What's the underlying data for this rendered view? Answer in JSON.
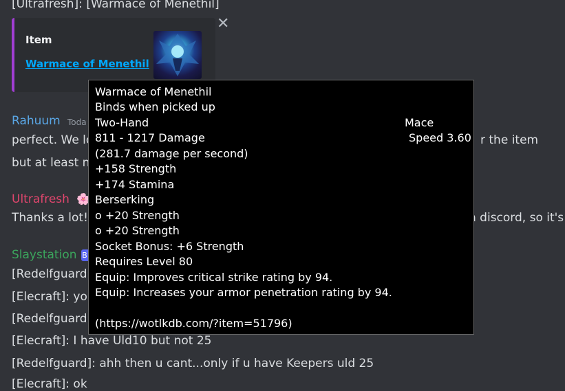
{
  "top_line": "[Ultrafresh]:  [Warmace of Menethil]",
  "embed": {
    "kind": "Item",
    "link": "Warmace of Menethil",
    "close_icon": "close-icon",
    "accent": "#a13ed3"
  },
  "messages": [
    {
      "author": "Rahuum",
      "author_color": "#5aa7e6",
      "timestamp": "Toda",
      "lines": [
        "perfect. We lo",
        "but at least n"
      ],
      "right_fragment": "r the item"
    },
    {
      "author": "Ultrafresh",
      "author_color": "#e0466d",
      "emoji": "🌸",
      "lines": [
        "Thanks a lot!"
      ],
      "right_fragment": "n discord, so it's"
    },
    {
      "author": "Slaystation",
      "author_color": "#3ba55c",
      "badge": "B",
      "lines": [
        "[Redelfguard",
        "[Elecraft]: yo",
        "[Redelfguard",
        "[Elecraft]: I have Uld10 but not 25",
        "[Redelfguard]: ahh then u cant...only if u have Keepers uld 25",
        "[Elecraft]: ok"
      ]
    }
  ],
  "tooltip": {
    "name": "Warmace of Menethil",
    "bind": "Binds when picked up",
    "slot": "Two-Hand",
    "type": "Mace",
    "damage": "811 - 1217 Damage",
    "speed": "Speed 3.60",
    "dps": "(281.7 damage per second)",
    "stats": [
      "+158 Strength",
      "+174 Stamina",
      "Berserking",
      "o +20 Strength",
      "o +20 Strength",
      "Socket Bonus: +6 Strength",
      "Requires Level 80",
      "Equip: Improves critical strike rating by 94.",
      "Equip: Increases your armor penetration rating by 94."
    ],
    "url": "(https://wotlkdb.com/?item=51796)"
  }
}
